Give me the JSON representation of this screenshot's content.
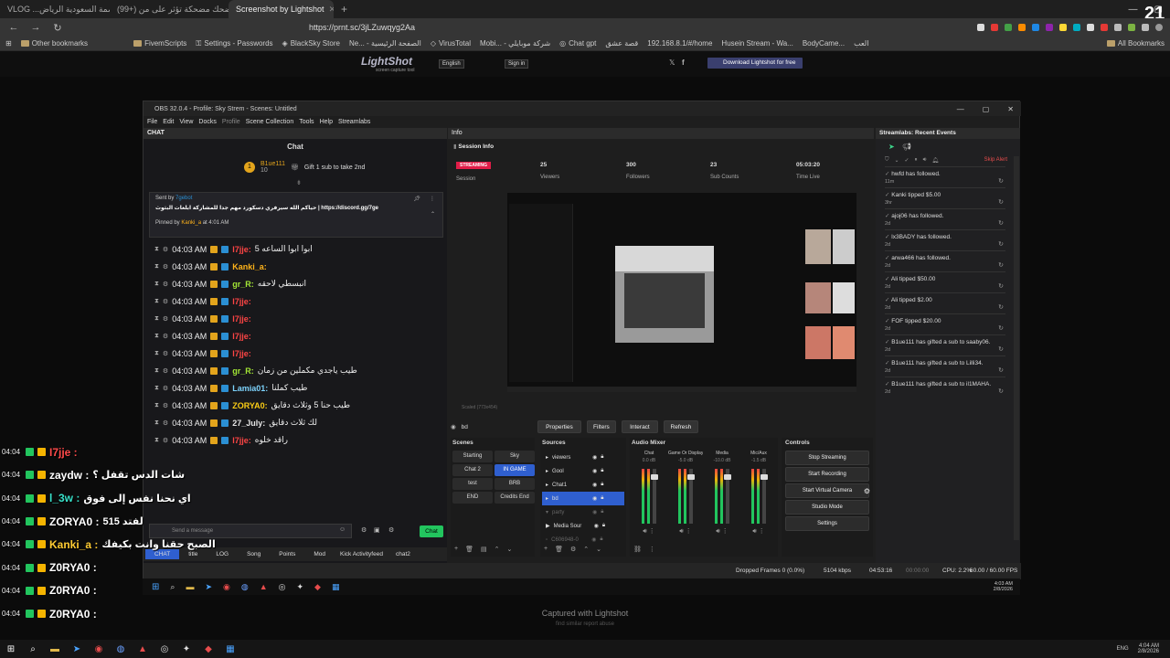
{
  "browser": {
    "tabs": [
      {
        "label": "VLOG ...التي العاصمة السعودية الرياض",
        "active": false
      },
      {
        "label": "(99+) تويتر ضحك مضحكة تؤثر على من",
        "active": false
      },
      {
        "label": "Screenshot by Lightshot",
        "active": true
      }
    ],
    "url": "https://prnt.sc/3jLZuwqyg2Aa",
    "bookmarks": [
      "Other bookmarks",
      "FivemScripts",
      "Settings - Passwords",
      "BlackSky Store",
      "Ne... - الصفحة الرئيسية",
      "VirusTotal",
      "Mobi... - شركة موبايلي",
      "Chat gpt",
      "قصة عشق",
      "192.168.8.1/#/home",
      "Husein Stream - Wa...",
      "BodyCame...",
      "العب"
    ],
    "all_bookmarks": "All Bookmarks"
  },
  "lightshot": {
    "logo": "LightShot",
    "logo_sub": "screen capture tool",
    "lang": "English",
    "signin": "Sign in",
    "download": "Download Lightshot for free",
    "captured": "Captured with Lightshot",
    "captured_links": "find similar    report abuse"
  },
  "obs": {
    "title": "OBS 32.0.4 - Profile: Sky Strem - Scenes: Untitled",
    "menu": [
      "File",
      "Edit",
      "View",
      "Docks",
      "Profile",
      "Scene Collection",
      "Tools",
      "Help",
      "Streamlabs"
    ],
    "chat_dock": "CHAT",
    "chat_title": "Chat",
    "gift_user": "B1ue111",
    "gift_count": "10",
    "gift_text": "Gift 1 sub to take 2nd",
    "pinned_sent_by": "Sent by",
    "pinned_sender": "7gebot",
    "pinned_msg": "حياكم الله سيرفري دسكورد مهم جدا للمشاركة ابلغات البثوث | https://discord.gg/7ge",
    "pinned_by_label": "Pinned by",
    "pinned_by": "Kanki_a",
    "pinned_time": "at 4:01 AM",
    "chat": [
      {
        "time": "04:03 AM",
        "user": "I7jje:",
        "color": "#ff4545",
        "msg": "ابوا ابوا الساعه 5"
      },
      {
        "time": "04:03 AM",
        "user": "Kanki_a:",
        "color": "#ffb31a",
        "msg": ""
      },
      {
        "time": "04:03 AM",
        "user": "gr_R:",
        "color": "#a3e635",
        "msg": "انبسطي لاحقه"
      },
      {
        "time": "04:03 AM",
        "user": "I7jje:",
        "color": "#ff4545",
        "msg": ""
      },
      {
        "time": "04:03 AM",
        "user": "I7jje:",
        "color": "#ff4545",
        "msg": ""
      },
      {
        "time": "04:03 AM",
        "user": "I7jje:",
        "color": "#ff4545",
        "msg": ""
      },
      {
        "time": "04:03 AM",
        "user": "I7jje:",
        "color": "#ff4545",
        "msg": ""
      },
      {
        "time": "04:03 AM",
        "user": "gr_R:",
        "color": "#a3e635",
        "msg": "طيب ياجدي مكملين من زمان"
      },
      {
        "time": "04:03 AM",
        "user": "Lamia01:",
        "color": "#7dd3fc",
        "msg": "طيب كملنا"
      },
      {
        "time": "04:03 AM",
        "user": "ZORYA0:",
        "color": "#facc15",
        "msg": "طيب حنا 5 وثلاث دقايق"
      },
      {
        "time": "04:03 AM",
        "user": "27_July:",
        "color": "#e5e5e5",
        "msg": "لك ثلاث دقايق"
      },
      {
        "time": "04:03 AM",
        "user": "I7jje:",
        "color": "#ff4545",
        "msg": "راقد خلوه"
      }
    ],
    "send_placeholder": "Send a message",
    "chat_button": "Chat",
    "chat_tabs": [
      "CHAT",
      "title",
      "LOG",
      "Song",
      "Points",
      "Mod",
      "Kick Activityfeed",
      "chat2"
    ],
    "info_dock": "Info",
    "session_info": "Session Info",
    "streaming": "STREAMING",
    "session": "Session",
    "stats": [
      {
        "value": "25",
        "label": "Viewers"
      },
      {
        "value": "300",
        "label": "Followers"
      },
      {
        "value": "23",
        "label": "Sub Counts"
      },
      {
        "value": "05:03:20",
        "label": "Time Live"
      }
    ],
    "scaled": "Scaled (773x454)",
    "selected_source": "bd",
    "toolbar_buttons": [
      "Properties",
      "Filters",
      "Interact",
      "Refresh"
    ],
    "scenes_title": "Scenes",
    "scenes": [
      {
        "left": "Starting",
        "right": "Sky"
      },
      {
        "left": "Chat 2",
        "right": "IN GAME"
      },
      {
        "left": "test",
        "right": "BRB"
      },
      {
        "left": "END",
        "right": "Credits End"
      }
    ],
    "sources_title": "Sources",
    "sources": [
      "viewers",
      "Gool",
      "Chat1",
      "bd",
      "party",
      "Media Sour",
      "C606948-0"
    ],
    "mixer_title": "Audio Mixer",
    "mixer_channels": [
      {
        "name": "Chat",
        "db": "0.0 dB"
      },
      {
        "name": "Game Or Display",
        "db": "-5.0 dB"
      },
      {
        "name": "Media",
        "db": "-10.0 dB"
      },
      {
        "name": "Mic/Aux",
        "db": "-1.5 dB"
      }
    ],
    "controls_title": "Controls",
    "controls": [
      "Stop Streaming",
      "Start Recording",
      "Start Virtual Camera",
      "Studio Mode",
      "Settings"
    ],
    "events_title": "Streamlabs: Recent Events",
    "skip_alert": "Skip Alert",
    "events": [
      {
        "text": "hwfd has followed.",
        "time": "11m"
      },
      {
        "text": "Kanki tipped $5.00",
        "time": "3hr"
      },
      {
        "text": "ajoj06 has followed.",
        "time": "2d"
      },
      {
        "text": "lx3BADY has followed.",
        "time": "2d"
      },
      {
        "text": "arwa466 has followed.",
        "time": "2d"
      },
      {
        "text": "Ali tipped $50.00",
        "time": "2d"
      },
      {
        "text": "Ali tipped $2.00",
        "time": "2d"
      },
      {
        "text": "FOF tipped $20.00",
        "time": "2d"
      },
      {
        "text": "B1ue111 has gifted a sub to saaby06.",
        "time": "2d"
      },
      {
        "text": "B1ue111 has gifted a sub to Lilli34.",
        "time": "2d"
      },
      {
        "text": "B1ue111 has gifted a sub to il1MAHA.",
        "time": "2d"
      }
    ],
    "status": {
      "dropped": "Dropped Frames 0 (0.0%)",
      "kbps": "5104 kbps",
      "live": "04:53:16",
      "rec": "00:00:00",
      "cpu": "CPU: 2.2%",
      "fps": "60.00 / 60.00 FPS"
    }
  },
  "overlay_chat": [
    {
      "time": "04:04",
      "user": "I7jje :",
      "color": "#ff4a4a",
      "msg": ""
    },
    {
      "time": "04:04",
      "user": "zaydw :",
      "color": "#ffffff",
      "msg": "شات الدس تقفل ؟"
    },
    {
      "time": "04:04",
      "user": "l_3w :",
      "color": "#38e0c8",
      "msg": "اي نحنا نفس إلى فوق"
    },
    {
      "time": "04:04",
      "user": "ZORYA0 :",
      "color": "#ffffff",
      "msg": "لفتد 515"
    },
    {
      "time": "04:04",
      "user": "Kanki_a :",
      "color": "#ffcc33",
      "msg": "الصبح حقنا وانت بكيفك"
    },
    {
      "time": "04:04",
      "user": "Z0RYA0 :",
      "color": "#ffffff",
      "msg": ""
    },
    {
      "time": "04:04",
      "user": "Z0RYA0 :",
      "color": "#ffffff",
      "msg": ""
    },
    {
      "time": "04:04",
      "user": "Z0RYA0 :",
      "color": "#ffffff",
      "msg": ""
    }
  ],
  "clock": {
    "time": "4:03 AM",
    "date": "2/8/2026"
  },
  "taskbar_clock": {
    "time": "4:04 AM",
    "date": "2/8/2026",
    "lang": "ENG"
  },
  "corner_badge": "21"
}
